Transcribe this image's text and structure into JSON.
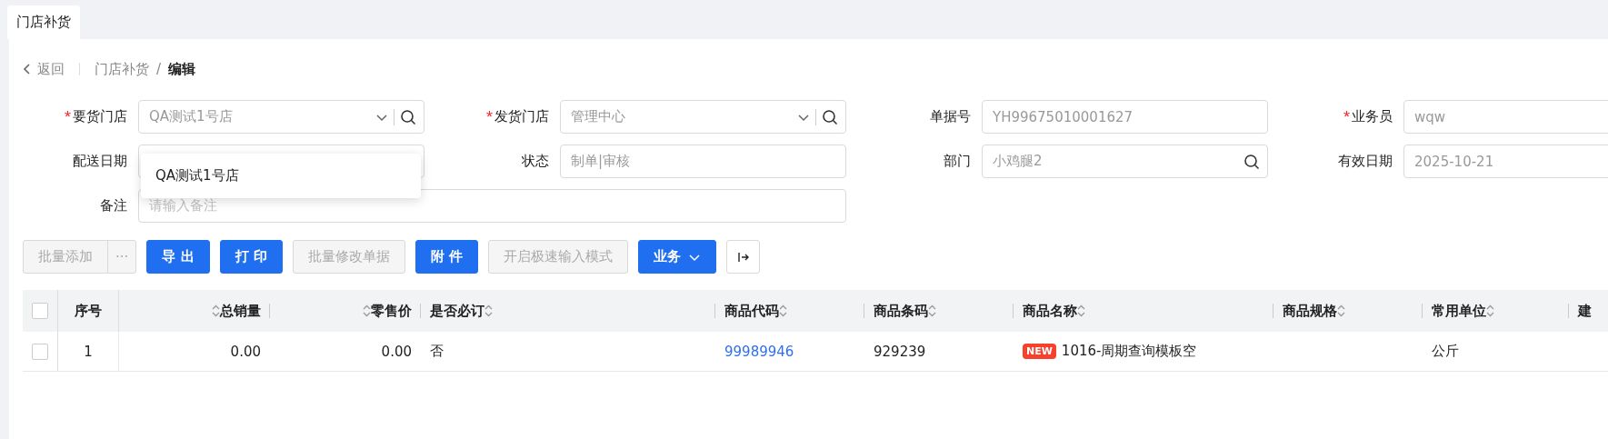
{
  "tabs": [
    {
      "label": "门店补货",
      "selected": true
    }
  ],
  "breadcrumb": {
    "back": "返回",
    "items": [
      {
        "label": "门店补货",
        "current": false
      },
      {
        "label": "编辑",
        "current": true
      }
    ],
    "separator": "/"
  },
  "form": {
    "fields": [
      {
        "label": "要货门店",
        "required": true,
        "value": "QA测试1号店",
        "kind": "select-search"
      },
      {
        "label": "发货门店",
        "required": true,
        "value": "管理中心",
        "kind": "select-search"
      },
      {
        "label": "单据号",
        "required": false,
        "value": "YH99675010001627",
        "kind": "text"
      },
      {
        "label": "业务员",
        "required": true,
        "value": "wqw",
        "kind": "text"
      },
      {
        "label": "配送日期",
        "required": false,
        "kind": "text"
      },
      {
        "label": "状态",
        "required": false,
        "value": "制单|审核",
        "kind": "text"
      },
      {
        "label": "部门",
        "required": false,
        "value": "小鸡腿2",
        "kind": "search"
      },
      {
        "label": "有效日期",
        "required": false,
        "value": "2025-10-21",
        "kind": "text"
      },
      {
        "label": "备注",
        "required": false,
        "placeholder": "请输入备注",
        "kind": "wide"
      }
    ],
    "dropdown": {
      "options": [
        "QA测试1号店"
      ]
    }
  },
  "toolbar": [
    {
      "label": "批量添加",
      "kind": "split-disabled",
      "more": "···"
    },
    {
      "label": "导 出",
      "kind": "primary"
    },
    {
      "label": "打 印",
      "kind": "primary"
    },
    {
      "label": "批量修改单据",
      "kind": "disabled"
    },
    {
      "label": "附 件",
      "kind": "primary"
    },
    {
      "label": "开启极速输入模式",
      "kind": "disabled"
    },
    {
      "label": "业务",
      "kind": "primary-dropdown"
    },
    {
      "kind": "icon"
    }
  ],
  "table": {
    "all_checked": false,
    "columns": [
      {
        "label": "序号",
        "kind": "index"
      },
      {
        "label": "总销量",
        "kind": "number"
      },
      {
        "label": "零售价",
        "kind": "number"
      },
      {
        "label": "是否必订",
        "kind": "text"
      },
      {
        "label": "商品代码",
        "kind": "text"
      },
      {
        "label": "商品条码",
        "kind": "text"
      },
      {
        "label": "商品名称",
        "kind": "text"
      },
      {
        "label": "商品规格",
        "kind": "text"
      },
      {
        "label": "常用单位",
        "kind": "text"
      },
      {
        "label": "建",
        "kind": "cut"
      }
    ],
    "rows": [
      {
        "checked": false,
        "cells": [
          {
            "text": "1"
          },
          {
            "text": "0.00"
          },
          {
            "text": "0.00"
          },
          {
            "text": "否"
          },
          {
            "text": "99989946",
            "kind": "link"
          },
          {
            "text": "929239"
          },
          {
            "text": "1016-周期查询模板空",
            "badge": "NEW"
          },
          {
            "text": ""
          },
          {
            "text": "公斤"
          },
          {
            "text": ""
          }
        ]
      }
    ]
  }
}
